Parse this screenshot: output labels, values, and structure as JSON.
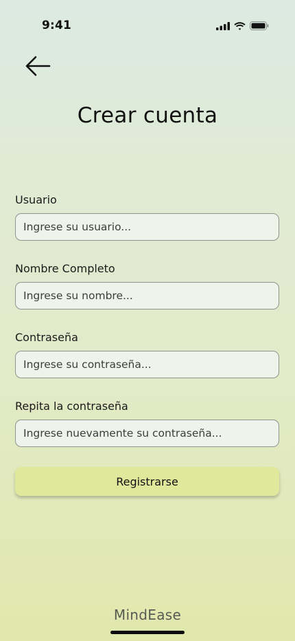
{
  "status_bar": {
    "time": "9:41",
    "icons": [
      "cellular-signal-icon",
      "wifi-icon",
      "battery-icon"
    ]
  },
  "header": {
    "back_icon": "arrow-left-icon",
    "title": "Crear cuenta"
  },
  "form": {
    "fields": [
      {
        "label": "Usuario",
        "placeholder": "Ingrese su usuario...",
        "value": ""
      },
      {
        "label": "Nombre Completo",
        "placeholder": "Ingrese su nombre...",
        "value": ""
      },
      {
        "label": "Contraseña",
        "placeholder": "Ingrese su contraseña...",
        "value": ""
      },
      {
        "label": "Repita la contraseña",
        "placeholder": "Ingrese nuevamente su contraseña...",
        "value": ""
      }
    ],
    "submit_label": "Registrarse"
  },
  "footer": {
    "brand": "MindEase"
  },
  "colors": {
    "background_top": "#dbeae2",
    "background_bottom": "#e1e8ad",
    "input_background": "#eef4ea",
    "button_background": "#dfe89b"
  }
}
